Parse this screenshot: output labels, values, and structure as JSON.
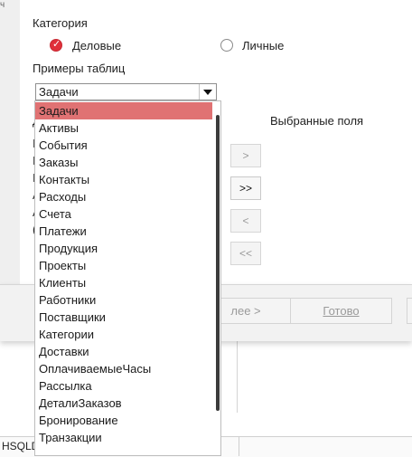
{
  "background": {
    "top_clip": "ч",
    "status_text": "HSQLDB встроенная"
  },
  "dialog": {
    "category_label": "Категория",
    "radio_business": {
      "label": "Деловые",
      "checked": true
    },
    "radio_personal": {
      "label": "Личные",
      "checked": false
    },
    "sample_tables_label": "Примеры таблиц",
    "combo_value": "Задачи",
    "selected_fields_label": "Выбранные поля",
    "left_fragments": [
      "Д",
      "I",
      "I",
      "I",
      "A",
      "A",
      "("
    ],
    "move_buttons": [
      ">",
      ">>",
      "<",
      "<<"
    ],
    "footer_buttons": {
      "next": "лее >",
      "finish": "Готово"
    }
  },
  "popup": {
    "items": [
      "Задачи",
      "Активы",
      "События",
      "Заказы",
      "Контакты",
      "Расходы",
      "Счета",
      "Платежи",
      "Продукция",
      "Проекты",
      "Клиенты",
      "Работники",
      "Поставщики",
      "Категории",
      "Доставки",
      "ОплачиваемыеЧасы",
      "Рассылка",
      "ДеталиЗаказов",
      "Бронирование",
      "Транзакции"
    ],
    "selected_index": 0
  },
  "colors": {
    "accent": "#e0303a",
    "selection": "#e07273"
  }
}
